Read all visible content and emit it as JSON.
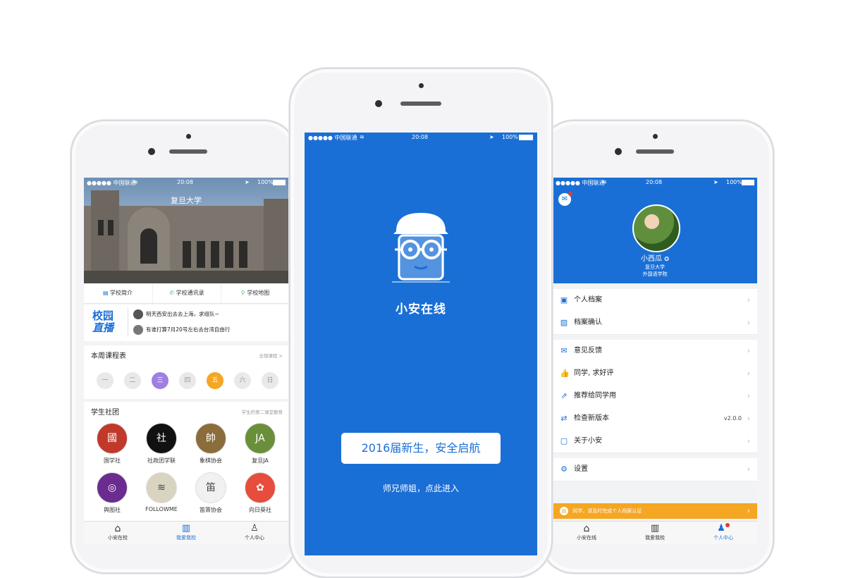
{
  "status": {
    "carrier": "●●●●● 中国联通",
    "time": "20:08",
    "battery": "100%"
  },
  "left": {
    "hero_title": "复旦大学",
    "quick_links": [
      {
        "label": "学校简介",
        "icon": "book-icon"
      },
      {
        "label": "学校通讯录",
        "icon": "phone-icon"
      },
      {
        "label": "学校地图",
        "icon": "map-pin-icon"
      }
    ],
    "live": {
      "logo_line1": "校园",
      "logo_line2": "直播",
      "items": [
        "明天西安出去去上海，求组队~",
        "有谁打算7月20号左右去台湾自由行"
      ]
    },
    "schedule": {
      "title": "本周课程表",
      "more": "全部课程 >",
      "days": [
        "一",
        "二",
        "三",
        "四",
        "五",
        "六",
        "日"
      ],
      "accent_days": {
        "三": "#9f7fe0",
        "五": "#f5a623"
      }
    },
    "clubs": {
      "title": "学生社团",
      "subtitle": "学生的第二课堂教育",
      "items": [
        "国学社",
        "社政团学联",
        "象棋协会",
        "复旦JA",
        "舆图社",
        "FOLLOWME",
        "笛箫协会",
        "向日葵社"
      ]
    },
    "tabs": [
      "小安在校",
      "我爱我校",
      "个人中心"
    ]
  },
  "center": {
    "app_name": "小安在线",
    "slogan": "2016届新生，安全启航",
    "enter": "师兄师姐，点此进入",
    "bg": "#1a6fd6"
  },
  "right": {
    "user": {
      "name": "小西瓜",
      "school": "复旦大学",
      "college": "外国语学院"
    },
    "rows1": [
      "个人档案",
      "档案确认"
    ],
    "rows2": [
      "意见反馈",
      "同学, 求好评",
      "推荐给同学用",
      "检查新版本",
      "关于小安"
    ],
    "version": "v2.0.0",
    "rows3": [
      "设置"
    ],
    "banner": "同学，请及时完成个人档案认证",
    "tabs": [
      "小安在线",
      "我爱我校",
      "个人中心"
    ]
  }
}
